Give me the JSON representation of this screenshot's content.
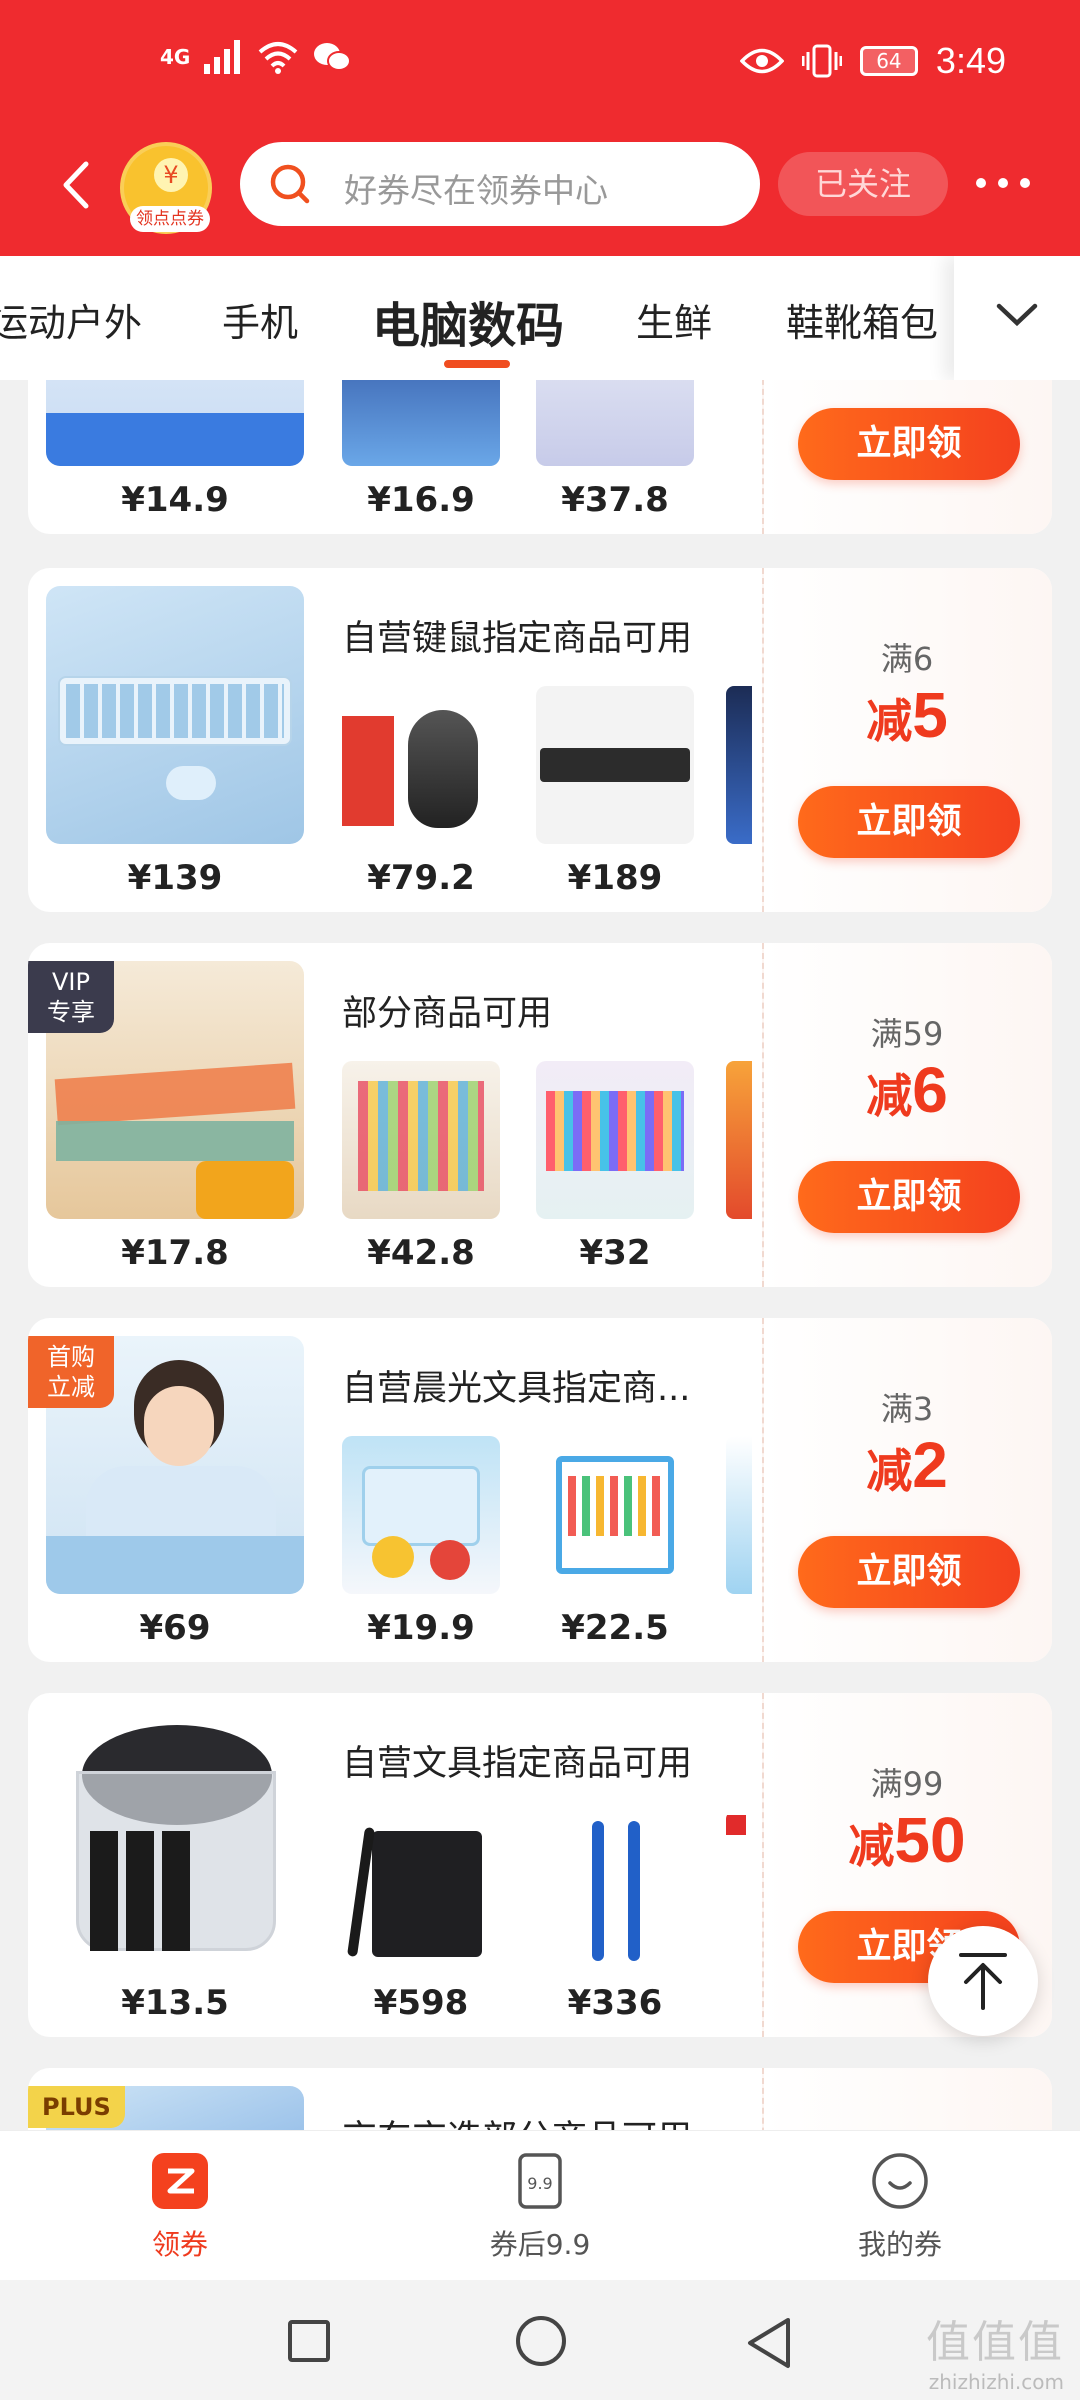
{
  "status_bar": {
    "network": "4G",
    "time": "3:49",
    "battery": "64"
  },
  "header": {
    "coupon_center_label": "领点点券",
    "search_placeholder": "好券尽在领券中心",
    "follow_label": "已关注"
  },
  "tabs": [
    "运动户外",
    "手机",
    "电脑数码",
    "生鲜",
    "鞋靴箱包"
  ],
  "active_tab": "电脑数码",
  "cards": [
    {
      "title": "",
      "main_price": "¥14.9",
      "items": [
        {
          "price": "¥16.9"
        },
        {
          "price": "¥37.8"
        }
      ],
      "condition": "",
      "discount_prefix": "",
      "discount_value": "",
      "claim_label": "立即领"
    },
    {
      "title": "自营键鼠指定商品可用",
      "main_price": "¥139",
      "items": [
        {
          "price": "¥79.2"
        },
        {
          "price": "¥189"
        }
      ],
      "condition": "满6",
      "discount_prefix": "减",
      "discount_value": "5",
      "claim_label": "立即领"
    },
    {
      "title": "部分商品可用",
      "main_price": "¥17.8",
      "badge": "VIP\n专享",
      "items": [
        {
          "price": "¥42.8"
        },
        {
          "price": "¥32"
        }
      ],
      "condition": "满59",
      "discount_prefix": "减",
      "discount_value": "6",
      "claim_label": "立即领"
    },
    {
      "title": "自营晨光文具指定商...",
      "main_price": "¥69",
      "badge": "首购\n立减",
      "items": [
        {
          "price": "¥19.9"
        },
        {
          "price": "¥22.5"
        }
      ],
      "condition": "满3",
      "discount_prefix": "减",
      "discount_value": "2",
      "claim_label": "立即领"
    },
    {
      "title": "自营文具指定商品可用",
      "main_price": "¥13.5",
      "items": [
        {
          "price": "¥598"
        },
        {
          "price": "¥336"
        }
      ],
      "condition": "满99",
      "discount_prefix": "减",
      "discount_value": "50",
      "claim_label": "立即领"
    },
    {
      "title": "京东京造部分商品可用",
      "badge": "PLUS"
    }
  ],
  "bottom_nav": [
    {
      "label": "领券",
      "icon": "coupon-icon",
      "active": true
    },
    {
      "label": "券后9.9",
      "icon": "price-tag-icon",
      "active": false
    },
    {
      "label": "我的券",
      "icon": "smile-icon",
      "active": false
    }
  ],
  "watermark": {
    "glyphs": "值值值",
    "site": "zhizhizhi.com"
  },
  "colors": {
    "brand_red": "#ef2b2f",
    "accent_orange": "#f4411e",
    "discount_red": "#ef3a1e"
  }
}
